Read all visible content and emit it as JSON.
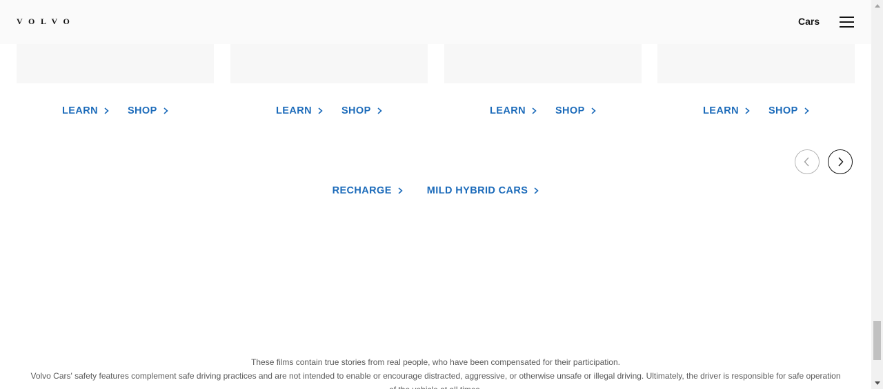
{
  "header": {
    "logo": "VOLVO",
    "nav_label": "Cars",
    "menu_icon": "hamburger-menu-icon"
  },
  "cards": [
    {
      "learn": "LEARN",
      "shop": "SHOP"
    },
    {
      "learn": "LEARN",
      "shop": "SHOP"
    },
    {
      "learn": "LEARN",
      "shop": "SHOP"
    },
    {
      "learn": "LEARN",
      "shop": "SHOP"
    }
  ],
  "carousel": {
    "prev_icon": "chevron-left-icon",
    "next_icon": "chevron-right-icon"
  },
  "bottom_links": {
    "recharge": "RECHARGE",
    "mild_hybrid": "MILD HYBRID CARS"
  },
  "disclaimer": {
    "line1": "These films contain true stories from real people, who have been compensated for their participation.",
    "line2": "Volvo Cars' safety features complement safe driving practices and are not intended to enable or encourage distracted, aggressive, or otherwise unsafe or illegal driving. Ultimately, the driver is responsible for safe operation of the vehicle at all times."
  },
  "colors": {
    "link": "#1c6bba",
    "text": "#141414",
    "header_bg": "#fafafa",
    "card_bg": "#f7f7f7"
  }
}
